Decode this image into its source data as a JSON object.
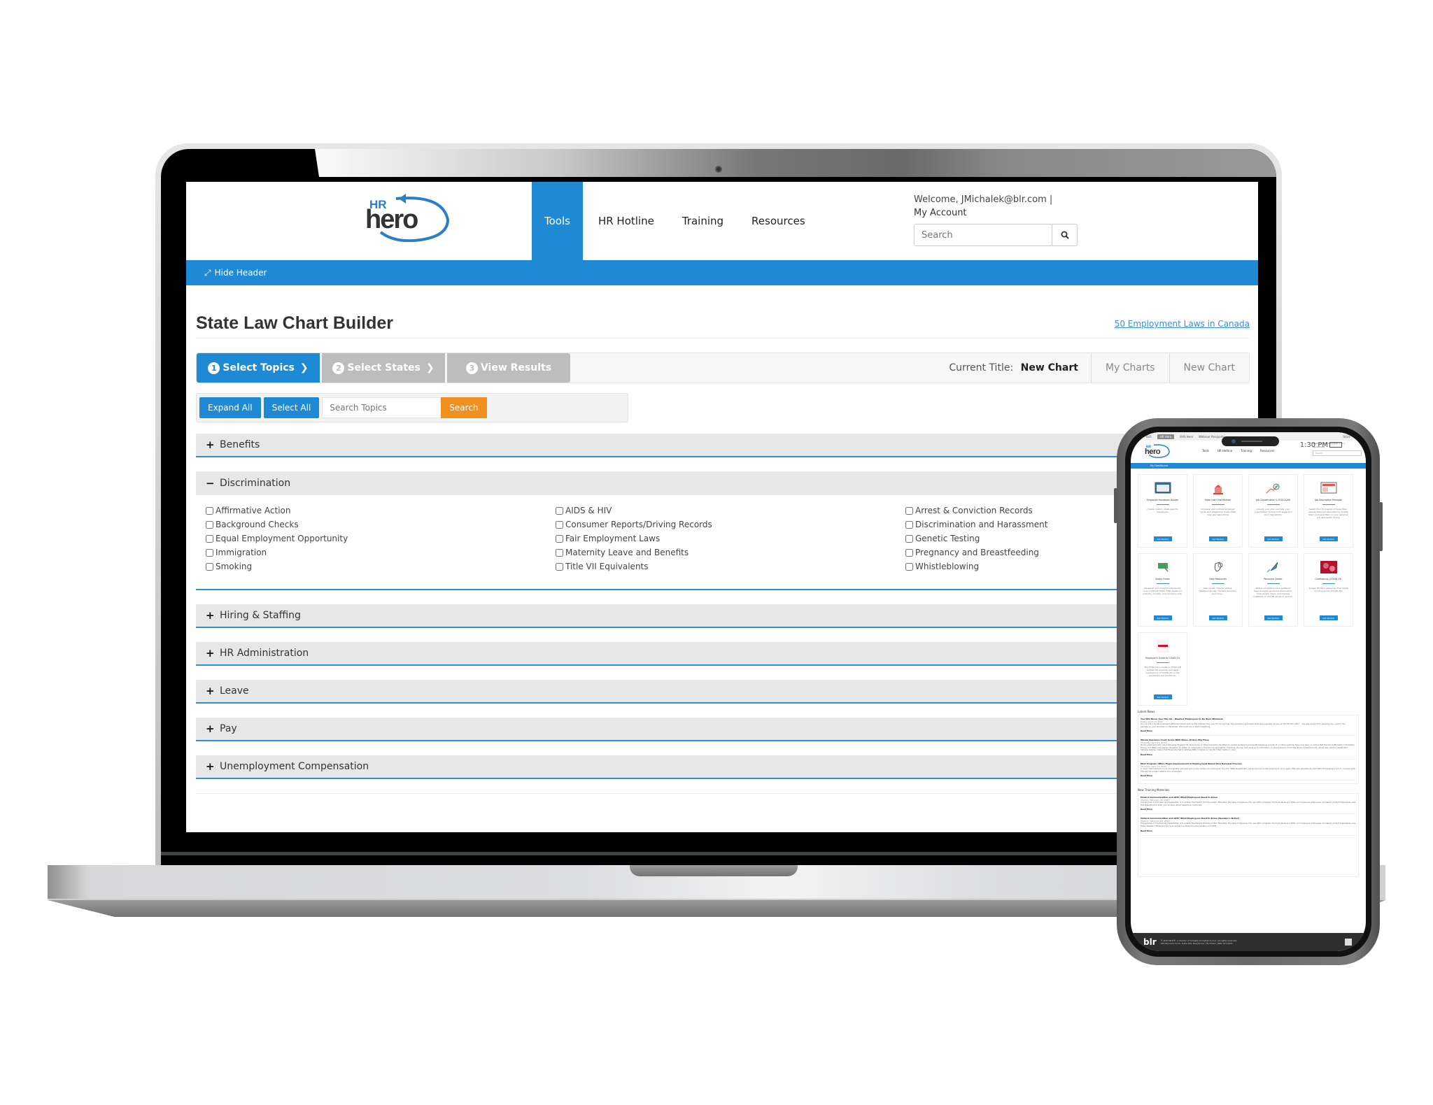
{
  "header": {
    "logo_alt": "HR hero",
    "nav": [
      {
        "label": "Tools",
        "active": true
      },
      {
        "label": "HR Hotline",
        "active": false
      },
      {
        "label": "Training",
        "active": false
      },
      {
        "label": "Resources",
        "active": false
      }
    ],
    "welcome": "Welcome, JMichalek@blr.com |",
    "my_account": "My Account",
    "search_placeholder": "Search",
    "search_icon": "search-icon"
  },
  "bluebar": {
    "hide_header": "Hide Header",
    "icon": "resize-icon"
  },
  "page": {
    "title": "State Law Chart Builder",
    "canada_link": "50 Employment Laws in Canada"
  },
  "steps": [
    {
      "num": "1",
      "label": "Select Topics",
      "active": true
    },
    {
      "num": "2",
      "label": "Select States",
      "active": false
    },
    {
      "num": "3",
      "label": "View Results",
      "active": false
    }
  ],
  "chart_tools": {
    "current_title_label": "Current Title:",
    "current_title_value": "New Chart",
    "my_charts": "My Charts",
    "new_chart": "New Chart"
  },
  "filter": {
    "expand_all": "Expand All",
    "select_all": "Select All",
    "search_placeholder": "Search Topics",
    "search_button": "Search"
  },
  "categories": [
    {
      "label": "Benefits",
      "expanded": false,
      "sign": "+"
    },
    {
      "label": "Discrimination",
      "expanded": true,
      "sign": "−",
      "columns": [
        [
          "Affirmative Action",
          "Background Checks",
          "Equal Employment Opportunity",
          "Immigration",
          "Smoking"
        ],
        [
          "AIDS & HIV",
          "Consumer Reports/Driving Records",
          "Fair Employment Laws",
          "Maternity Leave and Benefits",
          "Title VII Equivalents"
        ],
        [
          "Arrest & Conviction Records",
          "Discrimination and Harassment",
          "Genetic Testing",
          "Pregnancy and Breastfeeding",
          "Whistleblowing"
        ]
      ]
    },
    {
      "label": "Hiring & Staffing",
      "expanded": false,
      "sign": "+"
    },
    {
      "label": "HR Administration",
      "expanded": false,
      "sign": "+"
    },
    {
      "label": "Leave",
      "expanded": false,
      "sign": "+"
    },
    {
      "label": "Pay",
      "expanded": false,
      "sign": "+"
    },
    {
      "label": "Unemployment Compensation",
      "expanded": false,
      "sign": "+"
    }
  ],
  "phone": {
    "time": "1:30 PM",
    "topbar": [
      "BLR",
      "HR Hero",
      "EHS Hero",
      "Webinar Passports",
      "Store"
    ],
    "nav": [
      "Tools",
      "HR Hotline",
      "Training",
      "Resources"
    ],
    "welcome": "Welcome, JMichalek@blr.com |",
    "my_account": "My Account",
    "search_placeholder": "Search",
    "bluebar": "My Dashboard",
    "cards": [
      {
        "title": "Employee Handbook Builder",
        "desc": "Create custom, state-specific handbooks",
        "button": "Get Started"
      },
      {
        "title": "State Law Chart Builder",
        "desc": "Compare and contrast employer rights and obligations under state laws and regulations",
        "button": "Get Started"
      },
      {
        "title": "Job Classification & FLSA Audit",
        "desc": "Classify your jobs and help your organization comply with wage and hour regulations",
        "button": "Get Started"
      },
      {
        "title": "Job Description Manager",
        "desc": "Select from thousands of prewritten, standardized job descriptions, modify them and save them in your personal job description library",
        "button": "Get Started"
      },
      {
        "title": "Salary Finder",
        "desc": "Research and compare salaries for over 2,400 job titles. Filter based on industry, location, and company size.",
        "button": "Get Started"
      },
      {
        "title": "Help Resources",
        "desc": "User Guide, Tutorial Videos, Feedback Survey, Contact Numbers, and more...",
        "button": "Get Started"
      },
      {
        "title": "Resource Center",
        "desc": "Where our editors have gathered legal analysis, guidance documents, time savers, news, and training materials on hot HR issues or events.",
        "button": "Get Started"
      },
      {
        "title": "Coronavirus (COVID-19)",
        "desc": "Access HR Hero resources that relate to Coronavirus (COVID-19)",
        "button": "Get Started"
      },
      {
        "title": "Employer's Guide to COVID-19",
        "desc": "The Employer's Guide to COVID-19 tackles the practical and legal implications of COVID-19 on the workplace and workforce.",
        "button": "Get Started"
      }
    ],
    "latest_news_title": "Latest News",
    "news": [
      {
        "title": "You Will Never See This Ad - Wanted: Employees to Do Bare Minimum",
        "date": "Friday, April 14, 2023",
        "body": "You can tell a lot about people's attitude toward work by the phrases they use. For a long time, the workplace promoted what was popularly known as \"the Puritan ethic\" - success comes from keeping your nose to the grindstone, your shoulder on the wheel. Idle hands are a devil's plaything.",
        "read_more": "Read More"
      },
      {
        "title": "Illinois Supreme Court Scans BIPA Menu, Orders Big Fines",
        "date": "Thursday, April 13, 2023",
        "body": "Illinois employers who use employees' fingerprints, face scans, or other biometric identifiers to enable workers to access timekeeping, payroll, IT, or other systems have long been on notice that the Illinois Biometric Information Privacy Act (BIPA) imposes an obligation to obtain an employee's informed consent before collecting, storing, and using such information. A recent decision from the Illinois Supreme Court, which may lead to catastrophic damage awards, means that those who fail to address BIPA compliance may find their castle in ruins.",
        "read_more": "Read More"
      },
      {
        "title": "Pilot Program Offers Major Improvement in Employment-Based Visa Renewal Process",
        "date": "Thursday, April 13, 2023",
        "body": "A major improvement in U.S. immigration processing is on the horizon for employers. The U.S. State Department just announced a pilot program to once again offer visa renewals by mail without traveling to a U.S. consular post. This will be a major relief to U.S. employers.",
        "read_more": "Read More"
      }
    ],
    "training_title": "New Training Materials",
    "training": [
      {
        "title": "Hazard Communication and GHS: What Employees Need to Know",
        "date": "Monday, February 20, 2023",
        "body": "The purpose of this training presentation is to explain the Hazard Communication Standard, the risks of exposure, the new GHS-compliant chemical labels and SDSs, and measures employees can take to protect themselves. Use this PowerPoint to train your workers about hazardous chemicals.",
        "read_more": "Read More"
      },
      {
        "title": "Hazard Communication and GHS: What Employees Need to Know (Speaker's Notes)",
        "date": "Monday, February 20, 2023",
        "body": "The purpose of this training presentation is to explain the Hazard Communication Standard, the risks of exposure, the new GHS-compliant chemical labels and SDSs, and measures employees can take to protect themselves. Use these Speaker's Notes to train your workers on Hazard Communication and GHS.",
        "read_more": "Read More"
      }
    ],
    "footer_brand": "blr",
    "footer_line1": "© 2023 BLR®, a division of Simplify Compliance LLC. All rights reserved.",
    "footer_line2": "100 Winners Circle, Suite 300, Brentwood, TN 37027 | 800-727-5257"
  },
  "colors": {
    "primary": "#1e8ad6",
    "accent": "#f0901e",
    "step_inactive": "#bdbdbd",
    "link": "#3a8fd8"
  }
}
